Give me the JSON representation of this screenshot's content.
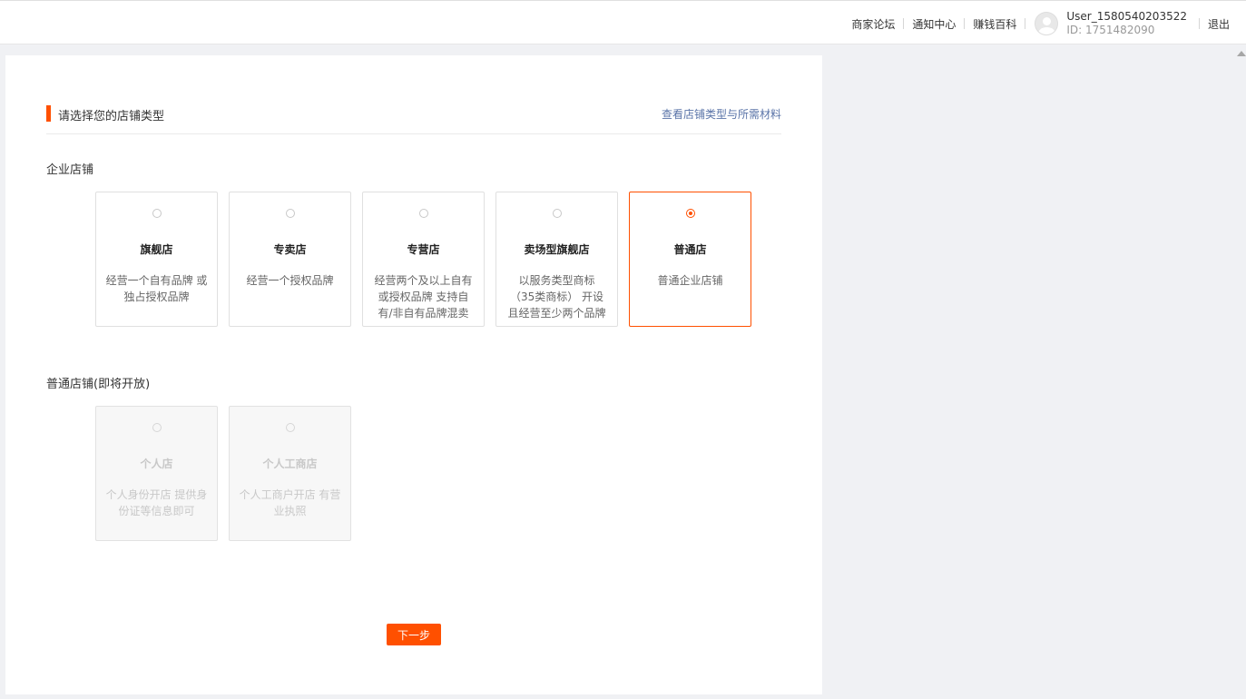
{
  "topbar": {
    "links": [
      "商家论坛",
      "通知中心",
      "赚钱百科"
    ],
    "user_name": "User_1580540203522",
    "user_id": "ID: 1751482090",
    "logout": "退出"
  },
  "page": {
    "title": "请选择您的店铺类型",
    "help_link": "查看店铺类型与所需材料"
  },
  "sections": [
    {
      "title": "企业店铺",
      "cards": [
        {
          "title": "旗舰店",
          "desc": "经营一个自有品牌 或独占授权品牌",
          "selected": false
        },
        {
          "title": "专卖店",
          "desc": "经营一个授权品牌",
          "selected": false
        },
        {
          "title": "专营店",
          "desc": "经营两个及以上自有或授权品牌 支持自有/非自有品牌混卖",
          "selected": false
        },
        {
          "title": "卖场型旗舰店",
          "desc": "以服务类型商标 （35类商标） 开设且经营至少两个品牌",
          "selected": false
        },
        {
          "title": "普通店",
          "desc": "普通企业店铺",
          "selected": true
        }
      ]
    },
    {
      "title": "普通店铺(即将开放)",
      "cards": [
        {
          "title": "个人店",
          "desc": "个人身份开店 提供身份证等信息即可",
          "disabled": true
        },
        {
          "title": "个人工商店",
          "desc": "个人工商户开店 有营业执照",
          "disabled": true
        }
      ]
    }
  ],
  "next_button": "下一步",
  "colors": {
    "accent": "#ff5000",
    "link": "#5a74a8"
  },
  "icons": {
    "avatar": "user-avatar-icon",
    "radio": "radio-icon",
    "scroll": "scroll-up-arrow-icon"
  }
}
